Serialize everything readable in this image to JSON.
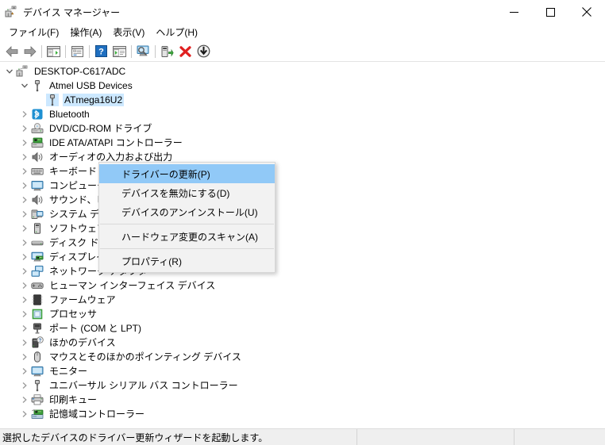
{
  "window": {
    "title": "デバイス マネージャー",
    "app_icon": "device-manager-icon",
    "minimize_label": "—",
    "maximize_label": "□",
    "close_label": "✕"
  },
  "menubar": {
    "items": [
      {
        "label": "ファイル(F)",
        "name": "menu-file"
      },
      {
        "label": "操作(A)",
        "name": "menu-action"
      },
      {
        "label": "表示(V)",
        "name": "menu-view"
      },
      {
        "label": "ヘルプ(H)",
        "name": "menu-help"
      }
    ]
  },
  "toolbar": {
    "buttons": [
      {
        "icon": "back-arrow-icon",
        "tooltip": "戻る"
      },
      {
        "icon": "forward-arrow-icon",
        "tooltip": "進む"
      },
      {
        "icon": "show-hide-console-tree-icon",
        "tooltip": "コンソール ツリーの表示/非表示"
      },
      {
        "icon": "properties-icon",
        "tooltip": "プロパティ"
      },
      {
        "icon": "help-icon",
        "tooltip": "ヘルプ"
      },
      {
        "icon": "scan-hardware-changes-icon",
        "tooltip": "ハードウェア変更のスキャン"
      },
      {
        "icon": "computer-monitor-icon",
        "tooltip": "デバイスの表示"
      },
      {
        "icon": "update-driver-icon",
        "tooltip": "ドライバーの更新"
      },
      {
        "icon": "uninstall-device-icon",
        "tooltip": "デバイスのアンインストール"
      },
      {
        "icon": "enable-device-icon",
        "tooltip": "デバイスを有効にする"
      }
    ]
  },
  "tree": {
    "root": {
      "label": "DESKTOP-C617ADC",
      "icon": "computer-icon",
      "expanded": true,
      "depth": 0
    },
    "items": [
      {
        "label": "Atmel USB Devices",
        "icon": "usb-icon",
        "expanded": true,
        "depth": 1,
        "selected": false
      },
      {
        "label": "ATmega16U2",
        "icon": "usb-device-icon",
        "expanded": null,
        "depth": 2,
        "selected": true
      },
      {
        "label": "Bluetooth",
        "icon": "bluetooth-icon",
        "expanded": false,
        "depth": 1,
        "selected": false
      },
      {
        "label": "DVD/CD-ROM ドライブ",
        "icon": "dvd-drive-icon",
        "expanded": false,
        "depth": 1,
        "selected": false
      },
      {
        "label": "IDE ATA/ATAPI コントローラー",
        "icon": "ide-controller-icon",
        "expanded": false,
        "depth": 1,
        "selected": false
      },
      {
        "label": "オーディオの入力および出力",
        "icon": "audio-icon",
        "expanded": false,
        "depth": 1,
        "selected": false
      },
      {
        "label": "キーボード",
        "icon": "keyboard-icon",
        "expanded": false,
        "depth": 1,
        "selected": false
      },
      {
        "label": "コンピューター",
        "icon": "monitor-icon",
        "expanded": false,
        "depth": 1,
        "selected": false
      },
      {
        "label": "サウンド、ビデオ、およびゲーム コントローラー",
        "icon": "sound-icon",
        "expanded": false,
        "depth": 1,
        "selected": false
      },
      {
        "label": "システム デバイス",
        "icon": "system-device-icon",
        "expanded": false,
        "depth": 1,
        "selected": false
      },
      {
        "label": "ソフトウェア デバイス",
        "icon": "software-device-icon",
        "expanded": false,
        "depth": 1,
        "selected": false
      },
      {
        "label": "ディスク ドライブ",
        "icon": "disk-drive-icon",
        "expanded": false,
        "depth": 1,
        "selected": false
      },
      {
        "label": "ディスプレイ アダプター",
        "icon": "display-adapter-icon",
        "expanded": false,
        "depth": 1,
        "selected": false
      },
      {
        "label": "ネットワーク アダプター",
        "icon": "network-adapter-icon",
        "expanded": false,
        "depth": 1,
        "selected": false
      },
      {
        "label": "ヒューマン インターフェイス デバイス",
        "icon": "hid-icon",
        "expanded": false,
        "depth": 1,
        "selected": false
      },
      {
        "label": "ファームウェア",
        "icon": "firmware-icon",
        "expanded": false,
        "depth": 1,
        "selected": false
      },
      {
        "label": "プロセッサ",
        "icon": "processor-icon",
        "expanded": false,
        "depth": 1,
        "selected": false
      },
      {
        "label": "ポート (COM と LPT)",
        "icon": "port-icon",
        "expanded": false,
        "depth": 1,
        "selected": false
      },
      {
        "label": "ほかのデバイス",
        "icon": "other-device-icon",
        "expanded": false,
        "depth": 1,
        "selected": false
      },
      {
        "label": "マウスとそのほかのポインティング デバイス",
        "icon": "mouse-icon",
        "expanded": false,
        "depth": 1,
        "selected": false
      },
      {
        "label": "モニター",
        "icon": "monitor-icon",
        "expanded": false,
        "depth": 1,
        "selected": false
      },
      {
        "label": "ユニバーサル シリアル バス コントローラー",
        "icon": "usb-icon",
        "expanded": false,
        "depth": 1,
        "selected": false
      },
      {
        "label": "印刷キュー",
        "icon": "printer-icon",
        "expanded": false,
        "depth": 1,
        "selected": false
      },
      {
        "label": "記憶域コントローラー",
        "icon": "storage-controller-icon",
        "expanded": false,
        "depth": 1,
        "selected": false
      }
    ]
  },
  "context_menu": {
    "visible": true,
    "highlighted_index": 0,
    "items": [
      {
        "label": "ドライバーの更新(P)",
        "name": "ctx-update-driver",
        "separator_after": false
      },
      {
        "label": "デバイスを無効にする(D)",
        "name": "ctx-disable-device",
        "separator_after": false
      },
      {
        "label": "デバイスのアンインストール(U)",
        "name": "ctx-uninstall-device",
        "separator_after": true
      },
      {
        "label": "ハードウェア変更のスキャン(A)",
        "name": "ctx-scan-hardware-changes",
        "separator_after": true
      },
      {
        "label": "プロパティ(R)",
        "name": "ctx-properties",
        "separator_after": false
      }
    ]
  },
  "statusbar": {
    "message": "選択したデバイスのドライバー更新ウィザードを起動します。",
    "pane2": "",
    "pane3": ""
  },
  "colors": {
    "selection": "#cce8ff",
    "menu_highlight": "#91c9f7",
    "menu_bg": "#f2f2f2",
    "statusbar_bg": "#efefef",
    "window_bg": "#ffffff",
    "accent_blue": "#1e90d2",
    "close_red": "#e81123"
  }
}
